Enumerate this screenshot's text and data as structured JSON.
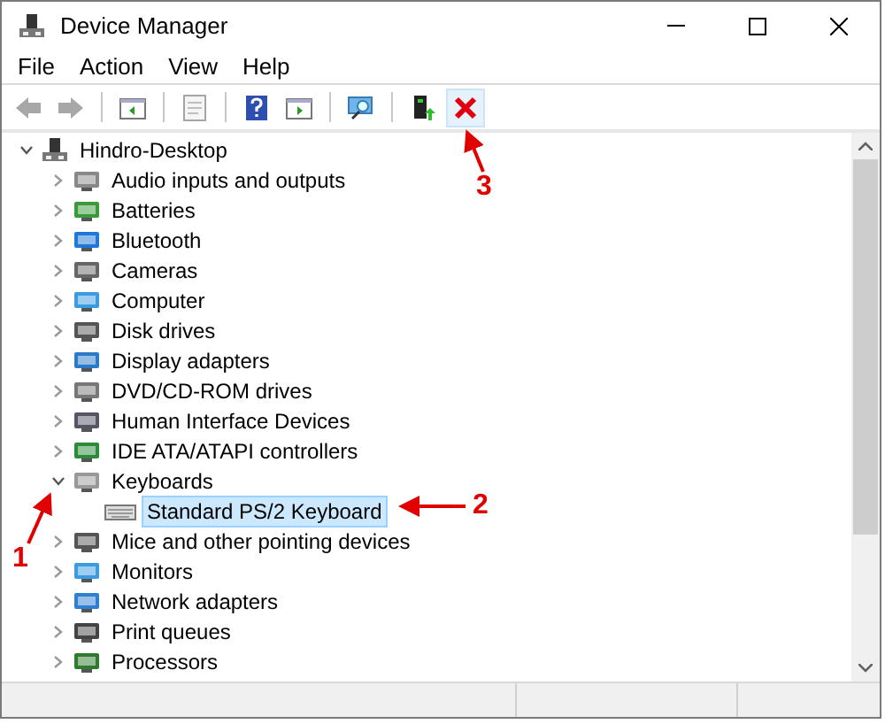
{
  "window": {
    "title": "Device Manager"
  },
  "menu": [
    "File",
    "Action",
    "View",
    "Help"
  ],
  "toolbar": [
    {
      "kind": "back",
      "disabled": true,
      "highlighted": false
    },
    {
      "kind": "forward",
      "disabled": true,
      "highlighted": false
    },
    {
      "kind": "separator"
    },
    {
      "kind": "console-tree",
      "disabled": false,
      "highlighted": false
    },
    {
      "kind": "separator"
    },
    {
      "kind": "properties",
      "disabled": true,
      "highlighted": false
    },
    {
      "kind": "separator"
    },
    {
      "kind": "help",
      "disabled": false,
      "highlighted": false
    },
    {
      "kind": "action-pane",
      "disabled": false,
      "highlighted": false
    },
    {
      "kind": "separator"
    },
    {
      "kind": "scan",
      "disabled": false,
      "highlighted": false
    },
    {
      "kind": "separator"
    },
    {
      "kind": "update",
      "disabled": false,
      "highlighted": false
    },
    {
      "kind": "uninstall",
      "disabled": false,
      "highlighted": true
    }
  ],
  "tree": {
    "label": "Hindro-Desktop",
    "expanded": true,
    "selected": false,
    "children": [
      {
        "label": "Audio inputs and outputs",
        "expanded": false,
        "selected": false
      },
      {
        "label": "Batteries",
        "expanded": false,
        "selected": false
      },
      {
        "label": "Bluetooth",
        "expanded": false,
        "selected": false
      },
      {
        "label": "Cameras",
        "expanded": false,
        "selected": false
      },
      {
        "label": "Computer",
        "expanded": false,
        "selected": false
      },
      {
        "label": "Disk drives",
        "expanded": false,
        "selected": false
      },
      {
        "label": "Display adapters",
        "expanded": false,
        "selected": false
      },
      {
        "label": "DVD/CD-ROM drives",
        "expanded": false,
        "selected": false
      },
      {
        "label": "Human Interface Devices",
        "expanded": false,
        "selected": false
      },
      {
        "label": "IDE ATA/ATAPI controllers",
        "expanded": false,
        "selected": false
      },
      {
        "label": "Keyboards",
        "expanded": true,
        "selected": false,
        "children": [
          {
            "label": "Standard PS/2 Keyboard",
            "selected": true
          }
        ]
      },
      {
        "label": "Mice and other pointing devices",
        "expanded": false,
        "selected": false
      },
      {
        "label": "Monitors",
        "expanded": false,
        "selected": false
      },
      {
        "label": "Network adapters",
        "expanded": false,
        "selected": false
      },
      {
        "label": "Print queues",
        "expanded": false,
        "selected": false
      },
      {
        "label": "Processors",
        "expanded": false,
        "selected": false
      }
    ]
  },
  "annotations": [
    {
      "label": "3"
    },
    {
      "label": "2"
    },
    {
      "label": "1"
    }
  ]
}
